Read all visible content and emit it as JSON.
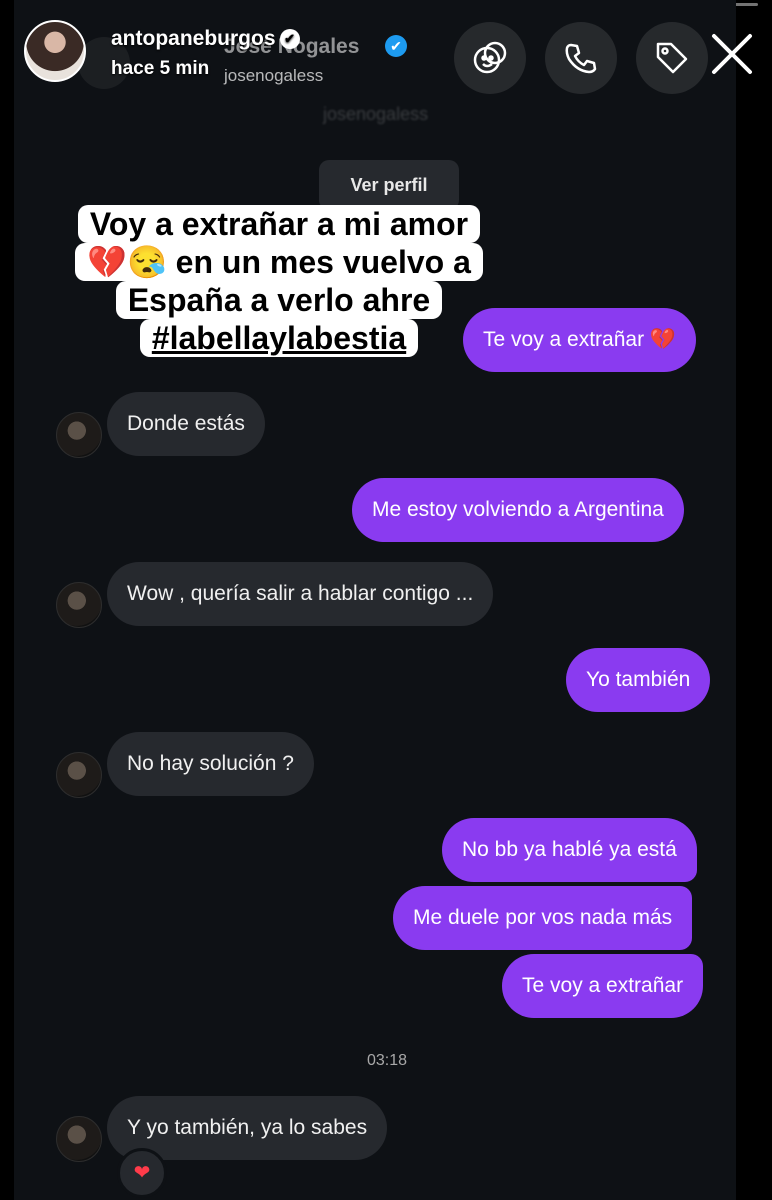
{
  "story": {
    "username": "antopaneburgos",
    "time": "hace 5 min",
    "verified_glyph": "✔"
  },
  "dm_header": {
    "name": "José Nogales",
    "username": "josenogaless",
    "username_faded": "josenogaless",
    "verified_glyph": "✔",
    "view_profile": "Ver perfil"
  },
  "sticker": {
    "line1": "Voy a extrañar a mi amor",
    "line2": "💔😪 en un mes vuelvo a",
    "line3": "España a verlo ahre",
    "line4": "#labellaylabestia"
  },
  "messages": [
    {
      "from": "me",
      "text": "Te voy a extrañar 💔"
    },
    {
      "from": "them",
      "text": "Donde estás"
    },
    {
      "from": "me",
      "text": "Me estoy volviendo a Argentina"
    },
    {
      "from": "them",
      "text": "Wow , quería salir a hablar contigo ..."
    },
    {
      "from": "me",
      "text": "Yo también"
    },
    {
      "from": "them",
      "text": "No hay solución ?"
    },
    {
      "from": "me",
      "text": "No bb ya hablé ya está"
    },
    {
      "from": "me",
      "text": "Me duele por vos nada más"
    },
    {
      "from": "me",
      "text": "Te voy a extrañar"
    },
    {
      "from": "them",
      "text": "Y yo también, ya lo sabes"
    }
  ],
  "timestamp": "03:18",
  "reaction": "❤",
  "icons": [
    "effects-icon",
    "phone-icon",
    "tag-icon",
    "close-icon"
  ],
  "colors": {
    "outgoing_bubble": "#8a3bf0",
    "incoming_bubble": "#26292e",
    "background": "#0e1115",
    "verified_blue": "#1d9bf0"
  }
}
